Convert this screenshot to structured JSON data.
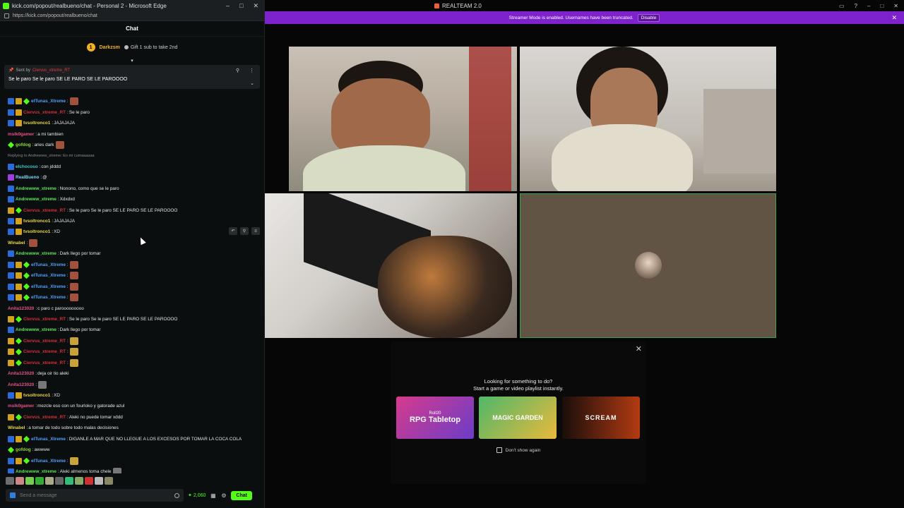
{
  "browser": {
    "title": "kick.com/popout/realbueno/chat - Personal 2 - Microsoft Edge",
    "url": "https://kick.com/popout/realbueno/chat",
    "window_controls": [
      "–",
      "□",
      "✕"
    ]
  },
  "chat": {
    "header": "Chat",
    "gifter": {
      "name": "Darkzsm",
      "level": "1",
      "gift_text": "Gift 1 sub to take 2nd"
    },
    "pinned": {
      "sent_by_label": "Sent by",
      "sender": "Ciervus_xtreme_RT",
      "message": "Se le paro Se le paro SE LE PARO SE LE PAROOOO"
    },
    "messages": [
      {
        "user": "elTunas_Xtreme",
        "color": "blue",
        "badges": [
          "blue",
          "gold",
          "green"
        ],
        "text": "",
        "emote": "pic"
      },
      {
        "user": "Ciervus_xtreme_RT",
        "color": "red",
        "badges": [
          "blue",
          "gold"
        ],
        "text": "Se le paro"
      },
      {
        "user": "tvsoltronco1",
        "color": "yellow",
        "badges": [
          "blue",
          "gold"
        ],
        "text": "JAJAJAJA"
      },
      {
        "user": "mslk0gamer",
        "color": "pink",
        "badges": [],
        "text": "a mi tambien"
      },
      {
        "user": "gofdog",
        "color": "lime",
        "badges": [
          "green"
        ],
        "text": "aries dark",
        "emote": "pic"
      },
      {
        "user": "",
        "color": "",
        "badges": [],
        "reply": "Replying to Andrewww_xtreme: En mi cumaaaaaa"
      },
      {
        "user": "elchocoso",
        "color": "teal",
        "badges": [
          "blue"
        ],
        "text": "con jdddd"
      },
      {
        "user": "RealBueno",
        "color": "cyan",
        "badges": [
          "purple"
        ],
        "text": "@"
      },
      {
        "user": "Andrewww_xtreme",
        "color": "green",
        "badges": [
          "blue"
        ],
        "text": "Nonono, como que se le paro"
      },
      {
        "user": "Andrewww_xtreme",
        "color": "green",
        "badges": [
          "blue"
        ],
        "text": "Xdxdxd"
      },
      {
        "user": "Ciervus_xtreme_RT",
        "color": "red",
        "badges": [
          "gold",
          "green"
        ],
        "text": "Se le paro Se le paro SE LE PARO SE LE PAROOOO"
      },
      {
        "user": "tvsoltronco1",
        "color": "yellow",
        "badges": [
          "blue",
          "gold"
        ],
        "text": "JAJAJAJA"
      },
      {
        "user": "tvsoltronco1",
        "color": "yellow",
        "badges": [
          "blue",
          "gold"
        ],
        "text": "XD"
      },
      {
        "user": "Winabel",
        "color": "yellow",
        "badges": [],
        "text": "",
        "emote": "pic"
      },
      {
        "user": "Andrewww_xtreme",
        "color": "green",
        "badges": [
          "blue"
        ],
        "text": "Dark llego por tomar"
      },
      {
        "user": "elTunas_Xtreme",
        "color": "blue",
        "badges": [
          "blue",
          "gold",
          "green"
        ],
        "text": "",
        "emote": "pic"
      },
      {
        "user": "elTunas_Xtreme",
        "color": "blue",
        "badges": [
          "blue",
          "gold",
          "green"
        ],
        "text": "",
        "emote": "pic"
      },
      {
        "user": "elTunas_Xtreme",
        "color": "blue",
        "badges": [
          "blue",
          "gold",
          "green"
        ],
        "text": "",
        "emote": "pic"
      },
      {
        "user": "elTunas_Xtreme",
        "color": "blue",
        "badges": [
          "blue",
          "gold",
          "green"
        ],
        "text": "",
        "emote": "pic"
      },
      {
        "user": "Anita123020",
        "color": "pink",
        "badges": [],
        "text": "c paro c parooooooooo"
      },
      {
        "user": "Ciervus_xtreme_RT",
        "color": "red",
        "badges": [
          "gold",
          "green"
        ],
        "text": "Se le paro Se le paro SE LE PARO SE LE PAROOOO"
      },
      {
        "user": "Andrewww_xtreme",
        "color": "green",
        "badges": [
          "blue"
        ],
        "text": "Dark llego por tomar"
      },
      {
        "user": "Ciervus_xtreme_RT",
        "color": "red",
        "badges": [
          "gold",
          "green"
        ],
        "text": "",
        "emote": "bird"
      },
      {
        "user": "Ciervus_xtreme_RT",
        "color": "red",
        "badges": [
          "gold",
          "green"
        ],
        "text": "",
        "emote": "bird"
      },
      {
        "user": "Ciervus_xtreme_RT",
        "color": "red",
        "badges": [
          "gold",
          "green"
        ],
        "text": "",
        "emote": "bird"
      },
      {
        "user": "Anita123020",
        "color": "pink",
        "badges": [],
        "text": "deja oir tio aleki"
      },
      {
        "user": "Anita123020",
        "color": "pink",
        "badges": [],
        "text": "",
        "emote": "cat"
      },
      {
        "user": "tvsoltronco1",
        "color": "yellow",
        "badges": [
          "blue",
          "gold"
        ],
        "text": "XD"
      },
      {
        "user": "mslk0gamer",
        "color": "pink",
        "badges": [],
        "text": "mezcle eso con un fourloko y gatorade azul"
      },
      {
        "user": "Ciervus_xtreme_RT",
        "color": "red",
        "badges": [
          "gold",
          "green"
        ],
        "text": "Aleki no puede tomar xddd"
      },
      {
        "user": "Winabel",
        "color": "yellow",
        "badges": [],
        "text": "a tomar de todo sobre todo malas decisiones"
      },
      {
        "user": "elTunas_Xtreme",
        "color": "blue",
        "badges": [
          "blue",
          "gold",
          "green"
        ],
        "text": "DIGANLE A MAR QUE NO LLEGUE A LOS EXCESOS POR TOMAR LA COCA COLA"
      },
      {
        "user": "gofdog",
        "color": "lime",
        "badges": [
          "green"
        ],
        "text": "awwww"
      },
      {
        "user": "elTunas_Xtreme",
        "color": "blue",
        "badges": [
          "blue",
          "gold",
          "green"
        ],
        "text": "",
        "emote": "bird"
      },
      {
        "user": "Andrewww_xtreme",
        "color": "green",
        "badges": [
          "blue"
        ],
        "text": "Aleki almenos toma chele",
        "emote": "cat"
      }
    ],
    "input_placeholder": "Send a message",
    "points": "2,060",
    "send_label": "Chat"
  },
  "app": {
    "title": "REALTEAM 2.0",
    "banner_text": "Streamer Mode is enabled. Usernames have been truncated.",
    "banner_button": "Disable",
    "popup": {
      "line1": "Looking for something to do?",
      "line2": "Start a game or video playlist instantly.",
      "cards": [
        {
          "title": "RPG Tabletop",
          "sub": "Roll20"
        },
        {
          "title": "MAGIC GARDEN"
        },
        {
          "title": "SCREAM"
        }
      ],
      "checkbox_label": "Don't show again"
    }
  },
  "colors": {
    "kick_green": "#53fc18",
    "banner_purple": "#7e22ce",
    "speaking_border": "#3aa14b"
  }
}
